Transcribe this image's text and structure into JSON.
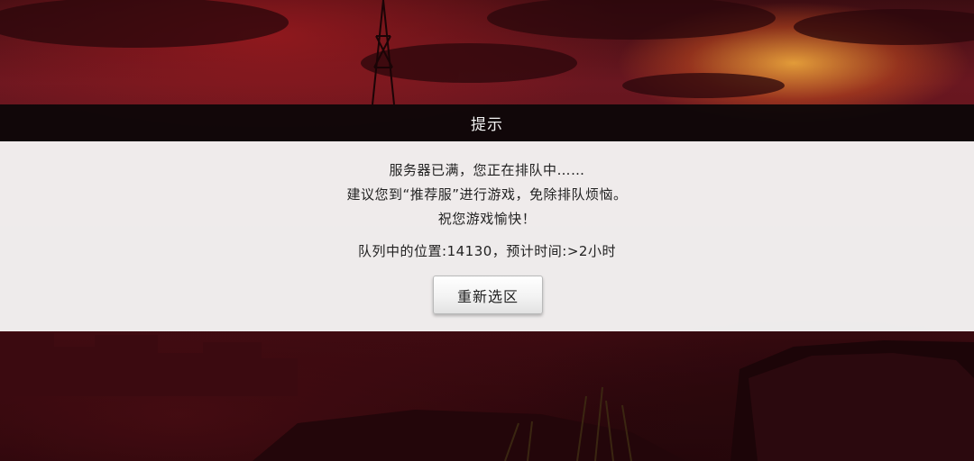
{
  "dialog": {
    "title": "提示",
    "message_line1": "服务器已满，您正在排队中……",
    "message_line2": "建议您到“推荐服”进行游戏，免除排队烦恼。",
    "message_line3": "祝您游戏愉快！",
    "queue_status": "队列中的位置:14130，预计时间:>2小时",
    "reselect_button": "重新选区"
  },
  "colors": {
    "header_bg": "#0a0608",
    "body_bg": "#f4f3f3",
    "text": "#222222",
    "title_text": "#f2f2f2"
  },
  "icons": [
    "tower-silhouette",
    "rock-cliff",
    "grass-tufts"
  ]
}
